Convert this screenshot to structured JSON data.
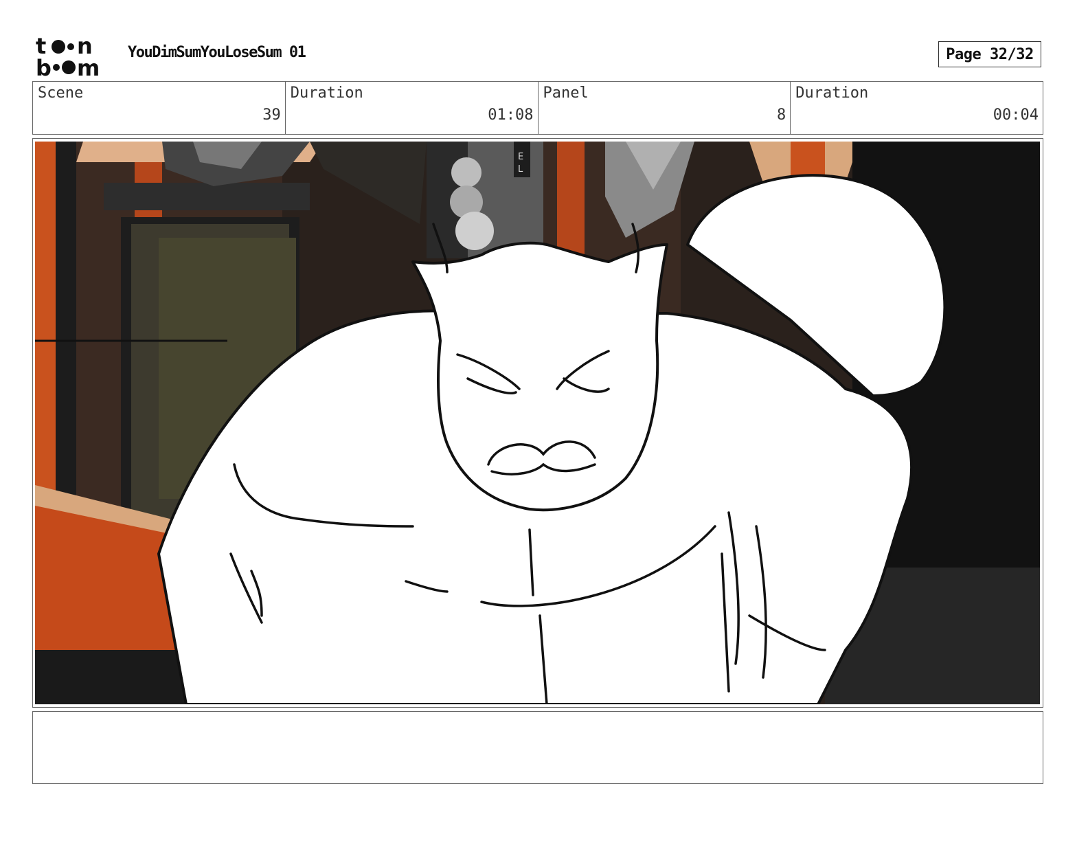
{
  "header": {
    "logo": "toonboom-logo",
    "title": "YouDimSumYouLoseSum 01",
    "page_label": "Page 32/32"
  },
  "info": {
    "scene_label": "Scene",
    "scene_value": "39",
    "scene_duration_label": "Duration",
    "scene_duration_value": "01:08",
    "panel_label": "Panel",
    "panel_value": "8",
    "panel_duration_label": "Duration",
    "panel_duration_value": "00:04"
  },
  "panel": {
    "image": "storyboard-sketch-cat-character-in-alley",
    "sign_letters": [
      "E",
      "L"
    ]
  },
  "notes": {
    "text": ""
  }
}
